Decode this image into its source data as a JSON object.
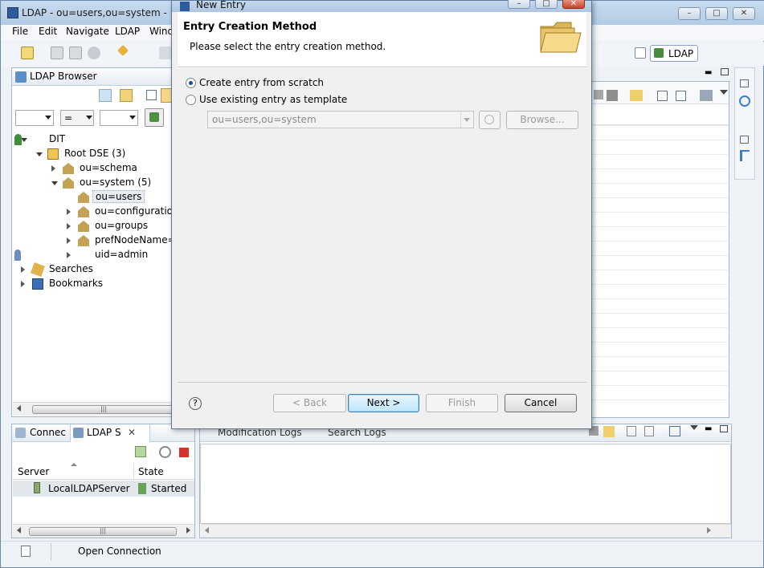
{
  "window": {
    "title": "LDAP - ou=users,ou=system - Loca"
  },
  "menu": [
    "File",
    "Edit",
    "Navigate",
    "LDAP",
    "Wind"
  ],
  "perspective": {
    "label": "LDAP"
  },
  "browser": {
    "tab": "LDAP Browser",
    "filter_op": "=",
    "tree": [
      {
        "label": "DIT",
        "indent": 0,
        "expand": "open",
        "icon": "dit-icon"
      },
      {
        "label": "Root DSE (3)",
        "indent": 1,
        "expand": "open",
        "icon": "root-dse-icon"
      },
      {
        "label": "ou=schema",
        "indent": 2,
        "expand": "closed",
        "icon": "entry-icon"
      },
      {
        "label": "ou=system (5)",
        "indent": 2,
        "expand": "open",
        "icon": "entry-icon"
      },
      {
        "label": "ou=users",
        "indent": 3,
        "expand": "none",
        "icon": "entry-icon",
        "selected": true
      },
      {
        "label": "ou=configuration",
        "indent": 3,
        "expand": "closed",
        "icon": "entry-icon"
      },
      {
        "label": "ou=groups",
        "indent": 3,
        "expand": "closed",
        "icon": "entry-icon"
      },
      {
        "label": "prefNodeName=sy",
        "indent": 3,
        "expand": "closed",
        "icon": "entry-icon"
      },
      {
        "label": "uid=admin",
        "indent": 3,
        "expand": "closed",
        "icon": "user-icon"
      },
      {
        "label": "Searches",
        "indent": 0,
        "expand": "closed",
        "icon": "searches-icon"
      },
      {
        "label": "Bookmarks",
        "indent": 0,
        "expand": "closed",
        "icon": "bookmarks-icon"
      }
    ]
  },
  "servers": {
    "tabs": [
      "Connec",
      "LDAP S"
    ],
    "columns": [
      "Server",
      "State"
    ],
    "rows": [
      {
        "server": "LocalLDAPServer",
        "state": "Started"
      }
    ]
  },
  "logs": {
    "tabs": [
      "Modification Logs",
      "Search Logs"
    ]
  },
  "status": {
    "text": "Open Connection"
  },
  "dialog": {
    "title": "New Entry",
    "heading": "Entry Creation Method",
    "description": "Please select the entry creation method.",
    "option_scratch": "Create entry from scratch",
    "option_template": "Use existing entry as template",
    "template_value": "ou=users,ou=system",
    "browse": "Browse...",
    "help": "?",
    "back": "< Back",
    "next": "Next >",
    "finish": "Finish",
    "cancel": "Cancel",
    "selected_option": "scratch"
  }
}
